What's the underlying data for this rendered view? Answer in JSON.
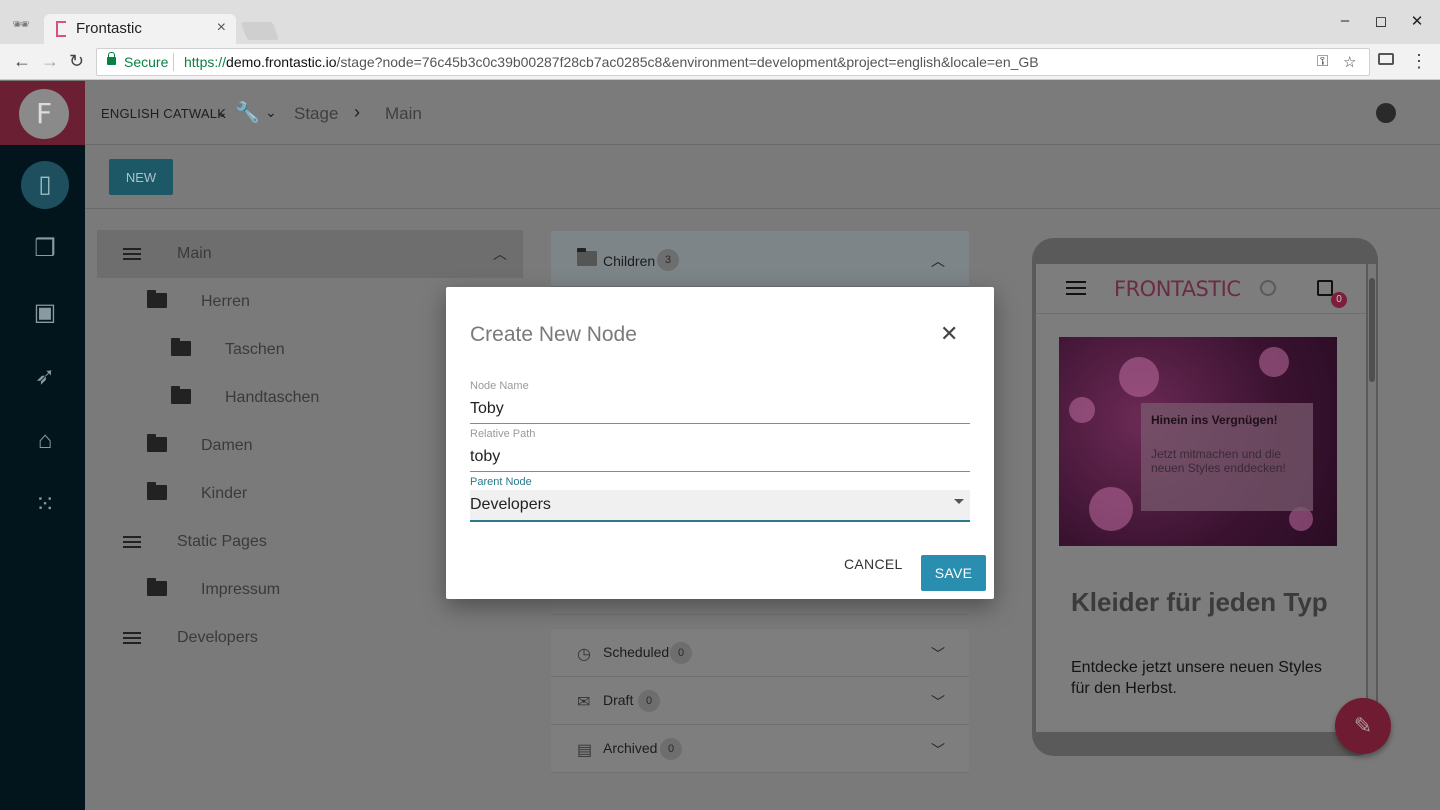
{
  "browser": {
    "tab_title": "Frontastic",
    "secure_label": "Secure",
    "url_scheme": "https://",
    "url_host": "demo.frontastic.io",
    "url_path": "/stage?node=76c45b3c0c39b00287f28cb7ac0285c8&environment=development&project=english&locale=en_GB"
  },
  "app": {
    "logo_letter": "F",
    "project_name": "ENGLISH CATWALK",
    "breadcrumb": [
      "Stage",
      "Main"
    ],
    "new_button": "NEW"
  },
  "tree": {
    "items": [
      {
        "label": "Main",
        "icon": "list-icon",
        "selected": true
      },
      {
        "label": "Herren",
        "icon": "folder-icon"
      },
      {
        "label": "Taschen",
        "icon": "folder-icon"
      },
      {
        "label": "Handtaschen",
        "icon": "folder-icon"
      },
      {
        "label": "Damen",
        "icon": "folder-icon"
      },
      {
        "label": "Kinder",
        "icon": "folder-icon"
      },
      {
        "label": "Static Pages",
        "icon": "list-icon"
      },
      {
        "label": "Impressum",
        "icon": "folder-icon"
      },
      {
        "label": "Developers",
        "icon": "list-icon"
      }
    ]
  },
  "panels": {
    "children": {
      "label": "Children",
      "count": "3"
    },
    "scheduled": {
      "label": "Scheduled",
      "count": "0"
    },
    "draft": {
      "label": "Draft",
      "count": "0"
    },
    "archived": {
      "label": "Archived",
      "count": "0"
    }
  },
  "preview": {
    "brand": "FRONTASTIC",
    "cart_count": "0",
    "hero_title": "Hinein ins Vergnügen!",
    "hero_text": "Jetzt mitmachen und die neuen Styles enddecken!",
    "heading": "Kleider für jeden Typ",
    "paragraph": "Entdecke jetzt unsere neuen Styles für den Herbst."
  },
  "dialog": {
    "title": "Create New Node",
    "node_name_label": "Node Name",
    "node_name_value": "Toby",
    "relative_path_label": "Relative Path",
    "relative_path_value": "toby",
    "parent_node_label": "Parent Node",
    "parent_node_value": "Developers",
    "cancel_label": "CANCEL",
    "save_label": "SAVE"
  },
  "colors": {
    "accent": "#2a8eb0",
    "brand": "#d4547a",
    "sidebar": "#02151c"
  }
}
